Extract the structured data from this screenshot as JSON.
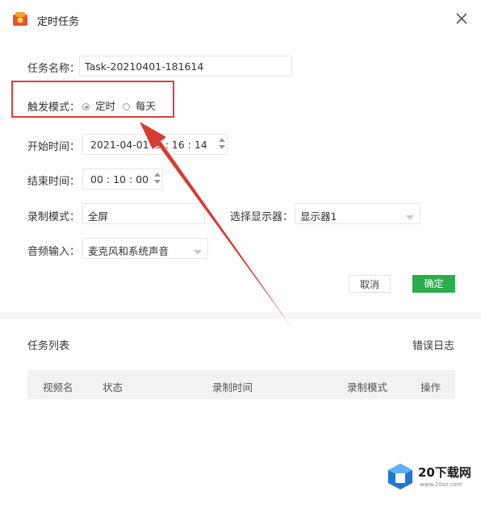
{
  "window": {
    "title": "定时任务"
  },
  "form": {
    "task_name_label": "任务名称：",
    "task_name_value": "Task-20210401-181614",
    "trigger_label": "触发模式：",
    "trigger_options": [
      "定时",
      "每天"
    ],
    "trigger_selected": "定时",
    "start_label": "开始时间：",
    "start_value": "2021-04-01",
    "start_time": "9 : 16 : 14",
    "end_label": "结束时间：",
    "end_value": "00 : 10 : 00",
    "record_mode_label": "录制模式：",
    "record_mode_value": "全屏",
    "display_label": "选择显示器：",
    "display_value": "显示器1",
    "audio_label": "音频输入：",
    "audio_value": "麦克风和系统声音"
  },
  "buttons": {
    "cancel": "取消",
    "ok": "确定"
  },
  "task_list": {
    "title": "任务列表",
    "error_log": "错误日志",
    "columns": [
      "视频名",
      "状态",
      "录制时间",
      "录制模式",
      "操作"
    ]
  },
  "watermark": {
    "text": "20下载网",
    "sub": "www.20xz.com"
  },
  "colors": {
    "highlight": "#e23d3d",
    "confirm": "#2bad4c",
    "arrow": "#d93a32"
  }
}
